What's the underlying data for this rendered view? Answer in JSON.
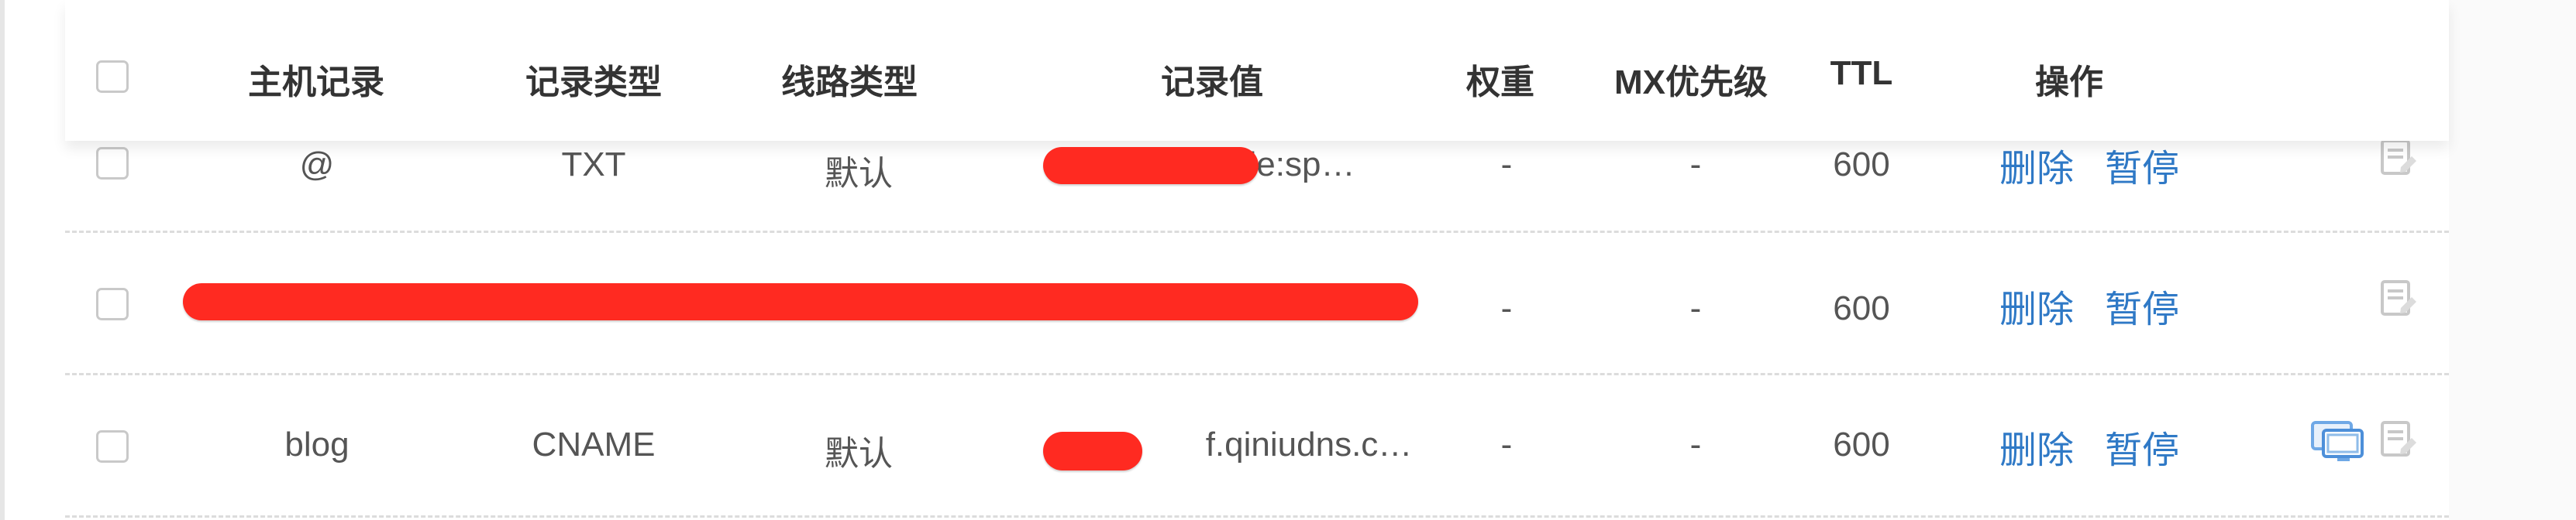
{
  "table": {
    "headers": {
      "host": "主机记录",
      "record_type": "记录类型",
      "line_type": "线路类型",
      "record_value": "记录值",
      "weight": "权重",
      "mx_priority": "MX优先级",
      "ttl": "TTL",
      "actions": "操作"
    },
    "rows": [
      {
        "host": "@",
        "record_type": "TXT",
        "line_type": "默认",
        "record_value": "le:sp…",
        "weight": "-",
        "mx_priority": "-",
        "ttl": "600",
        "delete_label": "删除",
        "pause_label": "暂停"
      },
      {
        "host": "",
        "record_type": "",
        "line_type": "",
        "record_value": "",
        "weight": "-",
        "mx_priority": "-",
        "ttl": "600",
        "delete_label": "删除",
        "pause_label": "暂停"
      },
      {
        "host": "blog",
        "record_type": "CNAME",
        "line_type": "默认",
        "record_value": "f.qiniudns.c…",
        "weight": "-",
        "mx_priority": "-",
        "ttl": "600",
        "delete_label": "删除",
        "pause_label": "暂停"
      }
    ]
  },
  "icons": {
    "note": "note-icon",
    "monitor": "monitor-icon"
  },
  "colors": {
    "link_blue": "#2f79c6",
    "redaction_red": "#ff2a21",
    "header_text": "#333333",
    "body_text": "#555555",
    "divider": "#dcdcdc"
  }
}
